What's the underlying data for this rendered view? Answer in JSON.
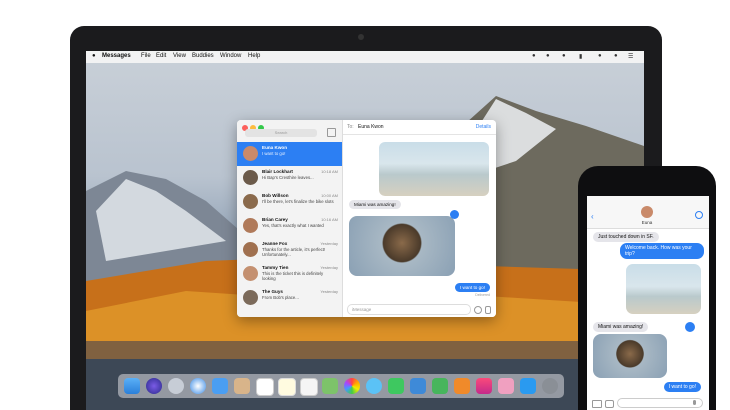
{
  "menubar": {
    "apple": "",
    "app": "Messages",
    "items": [
      "File",
      "Edit",
      "View",
      "Buddies",
      "Window",
      "Help"
    ]
  },
  "messages_window": {
    "search_placeholder": "Search",
    "chat_to_label": "To:",
    "chat_to_name": "Euna Kwon",
    "details_label": "Details",
    "conversations": [
      {
        "name": "Euna Kwon",
        "time": "",
        "preview": "I want to go!",
        "avatar_color": "#c98a6a"
      },
      {
        "name": "Blair Lockhart",
        "time": "10:18 AM",
        "preview": "Hi Bap's Cresthire leaves...",
        "avatar_color": "#6b5a4a"
      },
      {
        "name": "Bob Willson",
        "time": "10:00 AM",
        "preview": "I'll be there, let's finalize the bike slots",
        "avatar_color": "#8a6a4c"
      },
      {
        "name": "Brian Carey",
        "time": "10:16 AM",
        "preview": "Yes, that's exactly what I wanted",
        "avatar_color": "#b07a5a"
      },
      {
        "name": "Jeanne Fox",
        "time": "Yesterday",
        "preview": "Thanks for the article, it's perfect! Unfortunately...",
        "avatar_color": "#a0704f"
      },
      {
        "name": "Tammy Tien",
        "time": "Yesterday",
        "preview": "This is the ticket this is definitely looking",
        "avatar_color": "#c49070"
      },
      {
        "name": "The Guys",
        "time": "Yesterday",
        "preview": "From Bob's place...",
        "avatar_color": "#7b6a5a"
      }
    ],
    "bubble_incoming": "Miami was amazing!",
    "bubble_outgoing": "I want to go!",
    "delivered_label": "Delivered",
    "input_placeholder": "iMessage"
  },
  "iphone": {
    "back_count": "",
    "contact_name": "Euna",
    "messages": [
      {
        "from": "them",
        "text": "Just touched down in SF."
      },
      {
        "from": "me",
        "text": "Welcome back. How was your trip?"
      },
      {
        "from": "them",
        "text": "Miami was amazing!"
      },
      {
        "from": "me",
        "text": "I want to go!"
      }
    ]
  },
  "colors": {
    "accent": "#2c7ff3",
    "bubble_gray": "#e5e5ea"
  }
}
